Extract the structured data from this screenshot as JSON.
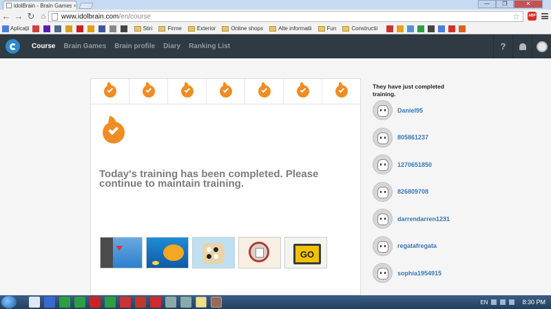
{
  "browser": {
    "tab_title": "idolBrain - Brain Games &",
    "tab_close": "×",
    "url_host": "www.idolbrain.com",
    "url_path": "/en/course",
    "window_controls": [
      "—",
      "❐",
      "✕"
    ],
    "bookmarks": [
      {
        "label": "Aplicații",
        "icon": "apps-icon",
        "color": "#4a7fd6"
      },
      {
        "label": "",
        "icon": "bookmark-icon",
        "color": "#d04040"
      },
      {
        "label": "",
        "icon": "yahoo-icon",
        "color": "#5a1bb3"
      },
      {
        "label": "",
        "icon": "bookmark-icon",
        "color": "#4a6a8a"
      },
      {
        "label": "",
        "icon": "bookmark-icon",
        "color": "#d9a020"
      },
      {
        "label": "",
        "icon": "bookmark-icon",
        "color": "#cc2020"
      },
      {
        "label": "",
        "icon": "bookmark-icon",
        "color": "#e0a010"
      },
      {
        "label": "",
        "icon": "facebook-icon",
        "color": "#3b5998"
      },
      {
        "label": "",
        "icon": "bookmark-icon",
        "color": "#888888"
      },
      {
        "label": "",
        "icon": "bookmark-icon",
        "color": "#444444"
      }
    ],
    "bookmark_folders": [
      "Stiri",
      "Firme",
      "Exterior",
      "Online shops",
      "Alte informatii",
      "Fun",
      "Constructii"
    ],
    "bookmark_tail_colors": [
      "#c8372d",
      "#e8a020",
      "#5a8fd8",
      "#2e9e44",
      "#444444",
      "#4a7fd6",
      "#d93025",
      "#e06020"
    ],
    "abp_label": "ABP"
  },
  "nav": {
    "links": [
      {
        "label": "Course",
        "active": true
      },
      {
        "label": "Brain Games",
        "active": false
      },
      {
        "label": "Brain profile",
        "active": false
      },
      {
        "label": "Diary",
        "active": false
      },
      {
        "label": "Ranking List",
        "active": false
      }
    ],
    "help_label": "?"
  },
  "course": {
    "streak_days_completed": 7,
    "message": "Today's training has been completed. Please continue to maintain training.",
    "game_thumbs": [
      "game-thumbnail-cliff",
      "game-thumbnail-fish",
      "game-thumbnail-board",
      "game-thumbnail-paper",
      "game-thumbnail-go-sign"
    ],
    "go_label": "GO"
  },
  "sidebar": {
    "title": "They have just completed training.",
    "users": [
      "Daniel95",
      "805861237",
      "1270651850",
      "826809708",
      "darrendarren1231",
      "regatafregata",
      "sophia1954915"
    ]
  },
  "taskbar": {
    "lang": "EN",
    "time": "8:30 PM"
  },
  "colors": {
    "accent_orange": "#f08c24",
    "nav_bg": "#2f3a42",
    "link_blue": "#3478b8"
  }
}
